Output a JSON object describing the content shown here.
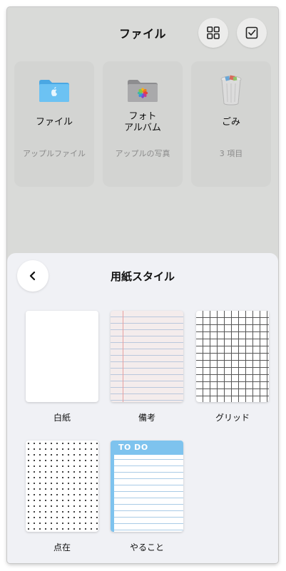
{
  "header": {
    "title": "ファイル",
    "grid_icon": "grid-icon",
    "select_icon": "checkbox-icon"
  },
  "folders": [
    {
      "icon": "apple-folder-icon",
      "title": "ファイル",
      "subtitle": "アップルファイル"
    },
    {
      "icon": "photos-folder-icon",
      "title_line1": "フォト",
      "title_line2": "アルバム",
      "subtitle": "アップルの写真"
    },
    {
      "icon": "trash-icon",
      "title": "ごみ",
      "subtitle": "3 項目"
    }
  ],
  "paper_sheet": {
    "back_icon": "chevron-left-icon",
    "title": "用紙スタイル",
    "styles": [
      {
        "label": "白紙",
        "pattern": "blank"
      },
      {
        "label": "備考",
        "pattern": "lined"
      },
      {
        "label": "グリッド",
        "pattern": "grid"
      },
      {
        "label": "点在",
        "pattern": "dotted"
      },
      {
        "label": "やること",
        "pattern": "todo",
        "header_text": "TO DO"
      }
    ]
  },
  "colors": {
    "background": "#d9dad8",
    "sheet": "#f0f1f5",
    "folder_blue": "#5ab6ec",
    "todo_blue": "#7ec3ee"
  }
}
